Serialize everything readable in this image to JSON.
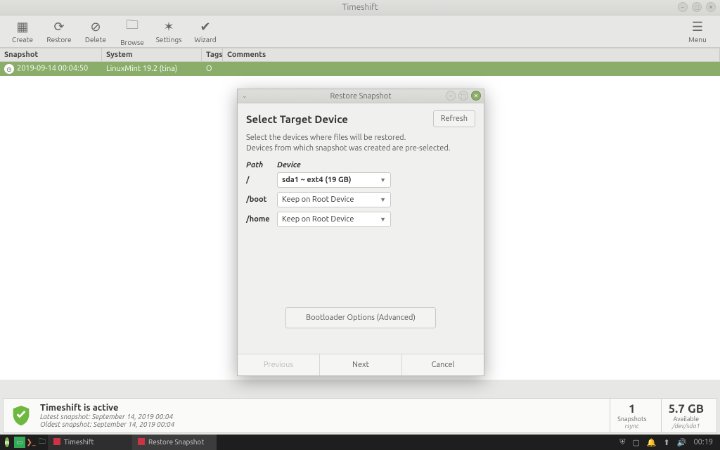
{
  "window": {
    "title": "Timeshift"
  },
  "toolbar": {
    "create": "Create",
    "restore": "Restore",
    "delete": "Delete",
    "browse": "Browse",
    "settings": "Settings",
    "wizard": "Wizard",
    "menu": "Menu"
  },
  "columns": {
    "snapshot": "Snapshot",
    "system": "System",
    "tags": "Tags",
    "comments": "Comments"
  },
  "rows": [
    {
      "snapshot": "2019-09-14 00:04:50",
      "system": "LinuxMint 19.2 (tina)",
      "tags": "O",
      "comments": ""
    }
  ],
  "dialog": {
    "title": "Restore Snapshot",
    "heading": "Select Target Device",
    "refresh": "Refresh",
    "desc1": "Select the devices where files will be restored.",
    "desc2": "Devices from which snapshot was created are pre-selected.",
    "col_path": "Path",
    "col_device": "Device",
    "paths": {
      "root": "/",
      "boot": "/boot",
      "home": "/home"
    },
    "devices": {
      "root": "sda1 ~ ext4 (19 GB)",
      "boot": "Keep on Root Device",
      "home": "Keep on Root Device"
    },
    "advanced": "Bootloader Options (Advanced)",
    "previous": "Previous",
    "next": "Next",
    "cancel": "Cancel"
  },
  "status": {
    "title": "Timeshift is active",
    "latest": "Latest snapshot: September 14, 2019 00:04",
    "oldest": "Oldest snapshot: September 14, 2019 00:04",
    "snapshots_count": "1",
    "snapshots_label": "Snapshots",
    "snapshots_sub": "rsync",
    "available": "5.7 GB",
    "available_label": "Available",
    "available_sub": "/dev/sda1"
  },
  "taskbar": {
    "app1": "Timeshift",
    "app2": "Restore Snapshot",
    "clock": "00:19"
  }
}
